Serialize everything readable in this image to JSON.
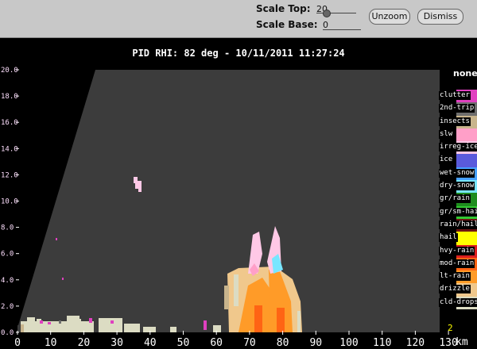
{
  "controls": {
    "scale_top_label": "Scale Top:",
    "scale_top_value": "20",
    "scale_base_label": "Scale Base:",
    "scale_base_value": "0",
    "unzoom_label": "Unzoom",
    "dismiss_label": "Dismiss"
  },
  "plot": {
    "title": "PID  RHI: 82 deg  -  10/11/2011 11:27:24",
    "x_ticks": [
      "0",
      "10",
      "20",
      "30",
      "40",
      "50",
      "60",
      "70",
      "80",
      "90",
      "100",
      "110",
      "120",
      "130"
    ],
    "x_unit": "km",
    "y_ticks": [
      "0.0",
      "2.0",
      "4.0",
      "6.0",
      "8.0",
      "10.0",
      "12.0",
      "14.0",
      "16.0",
      "18.0",
      "20.0"
    ],
    "corner_marker": "2",
    "background_color": "#3c3c3c"
  },
  "legend": {
    "none_label": "none",
    "items": [
      {
        "label": "clutter",
        "color": "#e040c0"
      },
      {
        "label": "2nd-trip",
        "color": "#6e6e6e"
      },
      {
        "label": "insects",
        "color": "#c8b48c"
      },
      {
        "label": "slw",
        "color": "#ff9fc8"
      },
      {
        "label": "irreg-ice",
        "color": "#ffc8e6"
      },
      {
        "label": "ice",
        "color": "#5a5adc"
      },
      {
        "label": "wet-snow",
        "color": "#46a0ff"
      },
      {
        "label": "dry-snow",
        "color": "#78e6ff"
      },
      {
        "label": "gr/rain",
        "color": "#1e8c1e"
      },
      {
        "label": "gr/sm-hail",
        "color": "#32c832"
      },
      {
        "label": "rain/hail",
        "color": "#6e1414"
      },
      {
        "label": "hail",
        "color": "#ffff00"
      },
      {
        "label": "hvy-rain",
        "color": "#dc1e1e"
      },
      {
        "label": "mod-rain",
        "color": "#ff6414"
      },
      {
        "label": "lt-rain",
        "color": "#ff9b28"
      },
      {
        "label": "drizzle",
        "color": "#f0c88c"
      },
      {
        "label": "cld-drops",
        "color": "#dcdcc3"
      }
    ]
  }
}
